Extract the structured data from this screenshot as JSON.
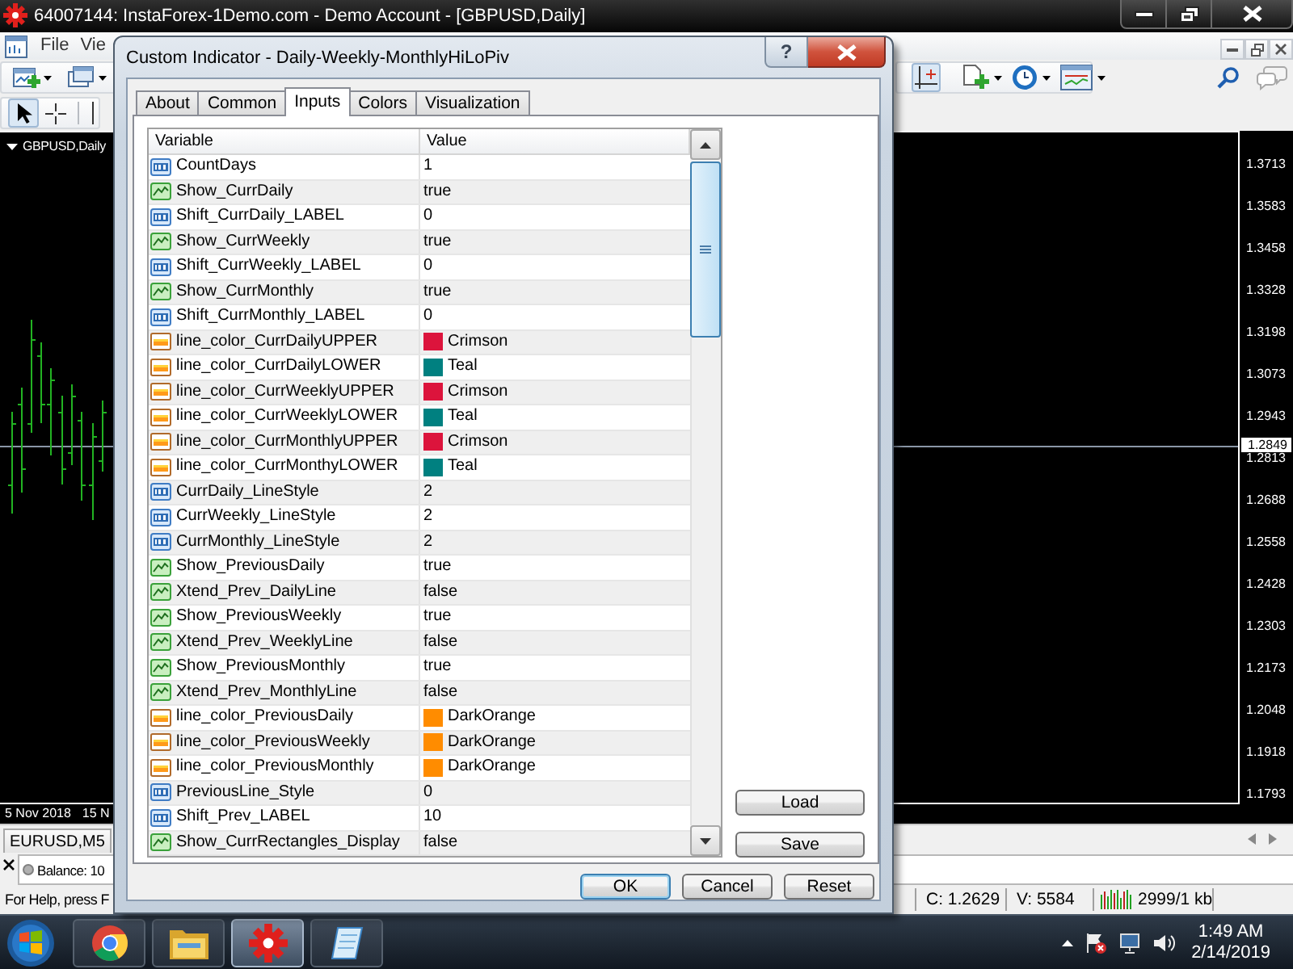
{
  "app_window": {
    "title": "64007144: InstaForex-1Demo.com - Demo Account - [GBPUSD,Daily]"
  },
  "menu_bar": {
    "items": [
      "File",
      "Vie"
    ]
  },
  "chart": {
    "title": "GBPUSD,Daily",
    "price_scale": [
      "1.3713",
      "1.3583",
      "1.3458",
      "1.3328",
      "1.3198",
      "1.3073",
      "1.2943",
      "1.2813",
      "1.2688",
      "1.2558",
      "1.2428",
      "1.2303",
      "1.2173",
      "1.2048",
      "1.1918",
      "1.1793"
    ],
    "current_price": "1.2849",
    "time_scale": [
      "5 Nov 2018",
      "15 N"
    ]
  },
  "dialog": {
    "title": "Custom Indicator - Daily-Weekly-MonthlyHiLoPiv",
    "help_button": "?",
    "tabs": [
      {
        "label": "About",
        "selected": false
      },
      {
        "label": "Common",
        "selected": false
      },
      {
        "label": "Inputs",
        "selected": true
      },
      {
        "label": "Colors",
        "selected": false
      },
      {
        "label": "Visualization",
        "selected": false
      }
    ],
    "table": {
      "columns": [
        "Variable",
        "Value"
      ],
      "rows": [
        {
          "kind": "int",
          "variable": "CountDays",
          "value": "1"
        },
        {
          "kind": "bool",
          "variable": "Show_CurrDaily",
          "value": "true"
        },
        {
          "kind": "int",
          "variable": "Shift_CurrDaily_LABEL",
          "value": "0"
        },
        {
          "kind": "bool",
          "variable": "Show_CurrWeekly",
          "value": "true"
        },
        {
          "kind": "int",
          "variable": "Shift_CurrWeekly_LABEL",
          "value": "0"
        },
        {
          "kind": "bool",
          "variable": "Show_CurrMonthly",
          "value": "true"
        },
        {
          "kind": "int",
          "variable": "Shift_CurrMonthly_LABEL",
          "value": "0"
        },
        {
          "kind": "color",
          "variable": "line_color_CurrDailyUPPER",
          "value": "Crimson",
          "color": "#dc143c"
        },
        {
          "kind": "color",
          "variable": "line_color_CurrDailyLOWER",
          "value": "Teal",
          "color": "#008080"
        },
        {
          "kind": "color",
          "variable": "line_color_CurrWeeklyUPPER",
          "value": "Crimson",
          "color": "#dc143c"
        },
        {
          "kind": "color",
          "variable": "line_color_CurrWeeklyLOWER",
          "value": "Teal",
          "color": "#008080"
        },
        {
          "kind": "color",
          "variable": "line_color_CurrMonthlyUPPER",
          "value": "Crimson",
          "color": "#dc143c"
        },
        {
          "kind": "color",
          "variable": "line_color_CurrMonthyLOWER",
          "value": "Teal",
          "color": "#008080"
        },
        {
          "kind": "int",
          "variable": "CurrDaily_LineStyle",
          "value": "2"
        },
        {
          "kind": "int",
          "variable": "CurrWeekly_LineStyle",
          "value": "2"
        },
        {
          "kind": "int",
          "variable": "CurrMonthly_LineStyle",
          "value": "2"
        },
        {
          "kind": "bool",
          "variable": "Show_PreviousDaily",
          "value": "true"
        },
        {
          "kind": "bool",
          "variable": "Xtend_Prev_DailyLine",
          "value": "false"
        },
        {
          "kind": "bool",
          "variable": "Show_PreviousWeekly",
          "value": "true"
        },
        {
          "kind": "bool",
          "variable": "Xtend_Prev_WeeklyLine",
          "value": "false"
        },
        {
          "kind": "bool",
          "variable": "Show_PreviousMonthly",
          "value": "true"
        },
        {
          "kind": "bool",
          "variable": "Xtend_Prev_MonthlyLine",
          "value": "false"
        },
        {
          "kind": "color",
          "variable": "line_color_PreviousDaily",
          "value": "DarkOrange",
          "color": "#ff8c00"
        },
        {
          "kind": "color",
          "variable": "line_color_PreviousWeekly",
          "value": "DarkOrange",
          "color": "#ff8c00"
        },
        {
          "kind": "color",
          "variable": "line_color_PreviousMonthly",
          "value": "DarkOrange",
          "color": "#ff8c00"
        },
        {
          "kind": "int",
          "variable": "PreviousLine_Style",
          "value": "0"
        },
        {
          "kind": "int",
          "variable": "Shift_Prev_LABEL",
          "value": "10"
        },
        {
          "kind": "bool",
          "variable": "Show_CurrRectangles_Display",
          "value": "false"
        }
      ]
    },
    "side_buttons": [
      "Load",
      "Save"
    ],
    "buttons": [
      {
        "label": "OK",
        "default": true
      },
      {
        "label": "Cancel",
        "default": false
      },
      {
        "label": "Reset",
        "default": false
      }
    ]
  },
  "chart_tabs": [
    {
      "label": "EURUSD,M5",
      "selected": false
    }
  ],
  "terminal": {
    "balance": "Balance: 10"
  },
  "status_bar": {
    "help": "For Help, press F",
    "close_price": "C: 1.2629",
    "volume": "V: 5584",
    "traffic": "2999/1 kb"
  },
  "taskbar": {
    "apps": [
      {
        "kind": "browser",
        "selected": false
      },
      {
        "kind": "folder",
        "selected": false
      },
      {
        "kind": "trading",
        "selected": true
      },
      {
        "kind": "notepad",
        "selected": false
      }
    ],
    "time": "1:49 AM",
    "date": "2/14/2019"
  }
}
